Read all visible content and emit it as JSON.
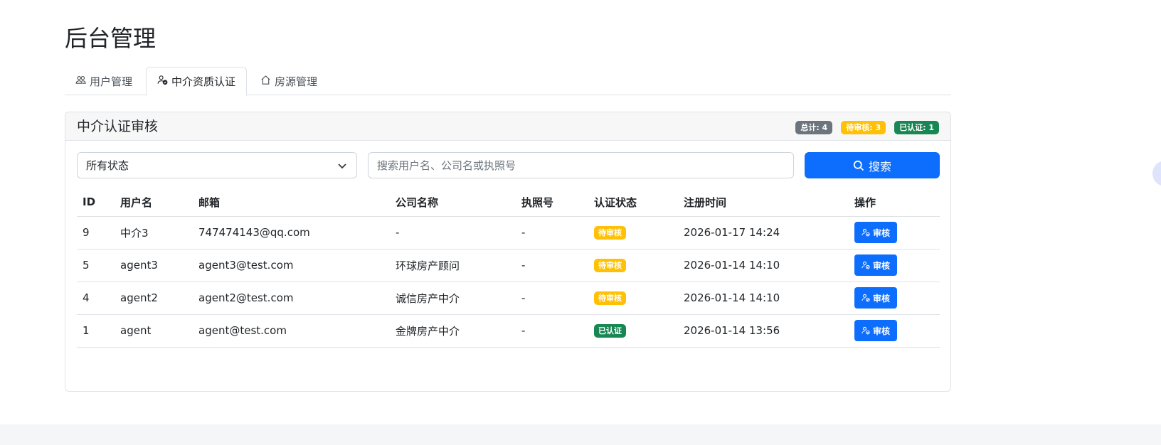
{
  "page": {
    "title": "后台管理"
  },
  "tabs": [
    {
      "label": "用户管理",
      "icon": "users-icon",
      "active": false
    },
    {
      "label": "中介资质认证",
      "icon": "person-check-icon",
      "active": true
    },
    {
      "label": "房源管理",
      "icon": "house-icon",
      "active": false
    }
  ],
  "card": {
    "title": "中介认证审核",
    "badges": {
      "total": "总计: 4",
      "pending": "待审核: 3",
      "verified": "已认证: 1"
    }
  },
  "filters": {
    "status_selected": "所有状态",
    "search_placeholder": "搜索用户名、公司名或执照号",
    "search_button": "搜索"
  },
  "table": {
    "columns": [
      "ID",
      "用户名",
      "邮箱",
      "公司名称",
      "执照号",
      "认证状态",
      "注册时间",
      "操作"
    ],
    "rows": [
      {
        "id": "9",
        "username": "中介3",
        "email": "747474143@qq.com",
        "company": "-",
        "license": "-",
        "status": "待审核",
        "status_type": "pending",
        "registered": "2026-01-17 14:24",
        "action": "审核"
      },
      {
        "id": "5",
        "username": "agent3",
        "email": "agent3@test.com",
        "company": "环球房产顾问",
        "license": "-",
        "status": "待审核",
        "status_type": "pending",
        "registered": "2026-01-14 14:10",
        "action": "审核"
      },
      {
        "id": "4",
        "username": "agent2",
        "email": "agent2@test.com",
        "company": "诚信房产中介",
        "license": "-",
        "status": "待审核",
        "status_type": "pending",
        "registered": "2026-01-14 14:10",
        "action": "审核"
      },
      {
        "id": "1",
        "username": "agent",
        "email": "agent@test.com",
        "company": "金牌房产中介",
        "license": "-",
        "status": "已认证",
        "status_type": "verified",
        "registered": "2026-01-14 13:56",
        "action": "审核"
      }
    ]
  },
  "colors": {
    "primary": "#0d6efd",
    "warning": "#ffc107",
    "success": "#198754",
    "secondary": "#6c757d"
  }
}
